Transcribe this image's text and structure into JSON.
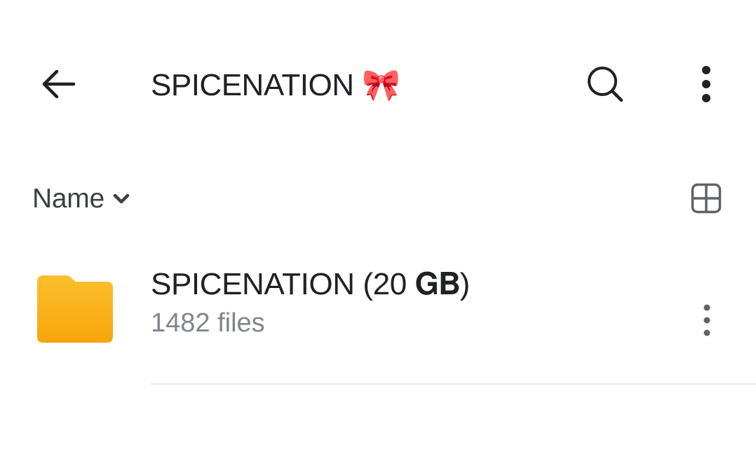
{
  "app_bar": {
    "title": "SPICENATION 🎀",
    "back_icon": "arrow-back-icon",
    "search_icon": "search-icon",
    "more_icon": "more-vert-icon"
  },
  "sort": {
    "label": "Name",
    "chevron_icon": "chevron-down-icon",
    "view_toggle_icon": "grid-view-icon"
  },
  "items": [
    {
      "title": "SPICENATION (20 𝐆𝐁)",
      "subtitle": "1482 files",
      "icon": "folder-icon",
      "icon_color": "#FBBC05",
      "more_icon": "more-vert-icon"
    }
  ],
  "colors": {
    "folder_top": "#FBC02D",
    "folder_bottom": "#F9A50B",
    "text_primary": "#202124",
    "text_secondary": "#80868b"
  }
}
